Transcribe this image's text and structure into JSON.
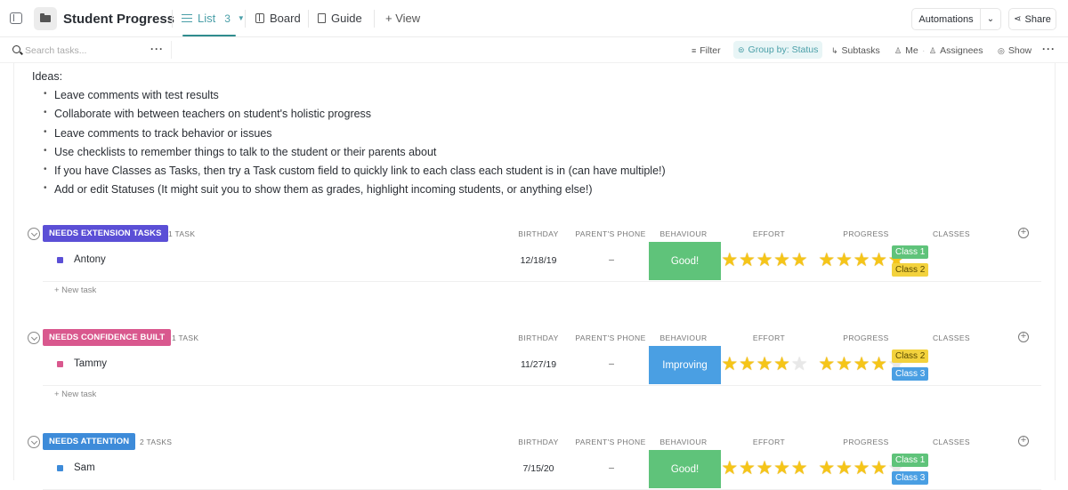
{
  "header": {
    "title": "Student Progress",
    "tabs": [
      {
        "label": "List",
        "count": "3",
        "active": true
      },
      {
        "label": "Board"
      },
      {
        "label": "Guide"
      },
      {
        "label": "+ View"
      }
    ],
    "automations_label": "Automations",
    "share_label": "Share"
  },
  "toolbar": {
    "search_placeholder": "Search tasks...",
    "filter_label": "Filter",
    "group_by_label": "Group by: Status",
    "subtasks_label": "Subtasks",
    "me_label": "Me",
    "assignees_label": "Assignees",
    "show_label": "Show"
  },
  "ideas": {
    "title": "Ideas:",
    "items": [
      "Leave comments with test results",
      "Collaborate with between teachers on student's holistic progress",
      "Leave comments to track behavior or issues",
      "Use checklists to remember things to talk to the student or their parents about",
      "If you have Classes as Tasks, then try a Task custom field to quickly link to each class each student is in (can have multiple!)",
      "Add or edit Statuses (It might suit you to show them as grades, highlight incoming students, or anything else!)"
    ]
  },
  "columns": {
    "birthday": "BIRTHDAY",
    "phone": "PARENT'S PHONE",
    "behaviour": "BEHAVIOUR",
    "effort": "EFFORT",
    "progress": "PROGRESS",
    "classes": "CLASSES"
  },
  "new_task_label": "+ New task",
  "colors": {
    "good": "#5fc37a",
    "improving": "#4a9fe3",
    "class1": "#5fc37a",
    "class2": "#f3d23d",
    "class3": "#4a9fe3",
    "accent": "#2f8c8e"
  },
  "groups": [
    {
      "status": "NEEDS EXTENSION TASKS",
      "color": "#5b4fd6",
      "count_label": "1 TASK",
      "tasks": [
        {
          "name": "Antony",
          "birthday": "12/18/19",
          "phone": "–",
          "behaviour": "Good!",
          "behaviour_color": "#5fc37a",
          "effort": 5,
          "progress": 5,
          "classes": [
            {
              "label": "Class 1",
              "bg": "#5fc37a",
              "fg": "#ffffff"
            },
            {
              "label": "Class 2",
              "bg": "#f3d23d",
              "fg": "#5a4a00"
            }
          ]
        }
      ]
    },
    {
      "status": "NEEDS CONFIDENCE BUILT",
      "color": "#d9588e",
      "count_label": "1 TASK",
      "tasks": [
        {
          "name": "Tammy",
          "birthday": "11/27/19",
          "phone": "–",
          "behaviour": "Improving",
          "behaviour_color": "#4a9fe3",
          "effort": 4,
          "progress": 4,
          "classes": [
            {
              "label": "Class 2",
              "bg": "#f3d23d",
              "fg": "#5a4a00"
            },
            {
              "label": "Class 3",
              "bg": "#4a9fe3",
              "fg": "#ffffff"
            }
          ]
        }
      ]
    },
    {
      "status": "NEEDS ATTENTION",
      "color": "#3d8bd9",
      "count_label": "2 TASKS",
      "tasks": [
        {
          "name": "Sam",
          "birthday": "7/15/20",
          "phone": "–",
          "behaviour": "Good!",
          "behaviour_color": "#5fc37a",
          "effort": 5,
          "progress": 4,
          "classes": [
            {
              "label": "Class 1",
              "bg": "#5fc37a",
              "fg": "#ffffff"
            },
            {
              "label": "Class 3",
              "bg": "#4a9fe3",
              "fg": "#ffffff"
            }
          ]
        }
      ]
    }
  ]
}
